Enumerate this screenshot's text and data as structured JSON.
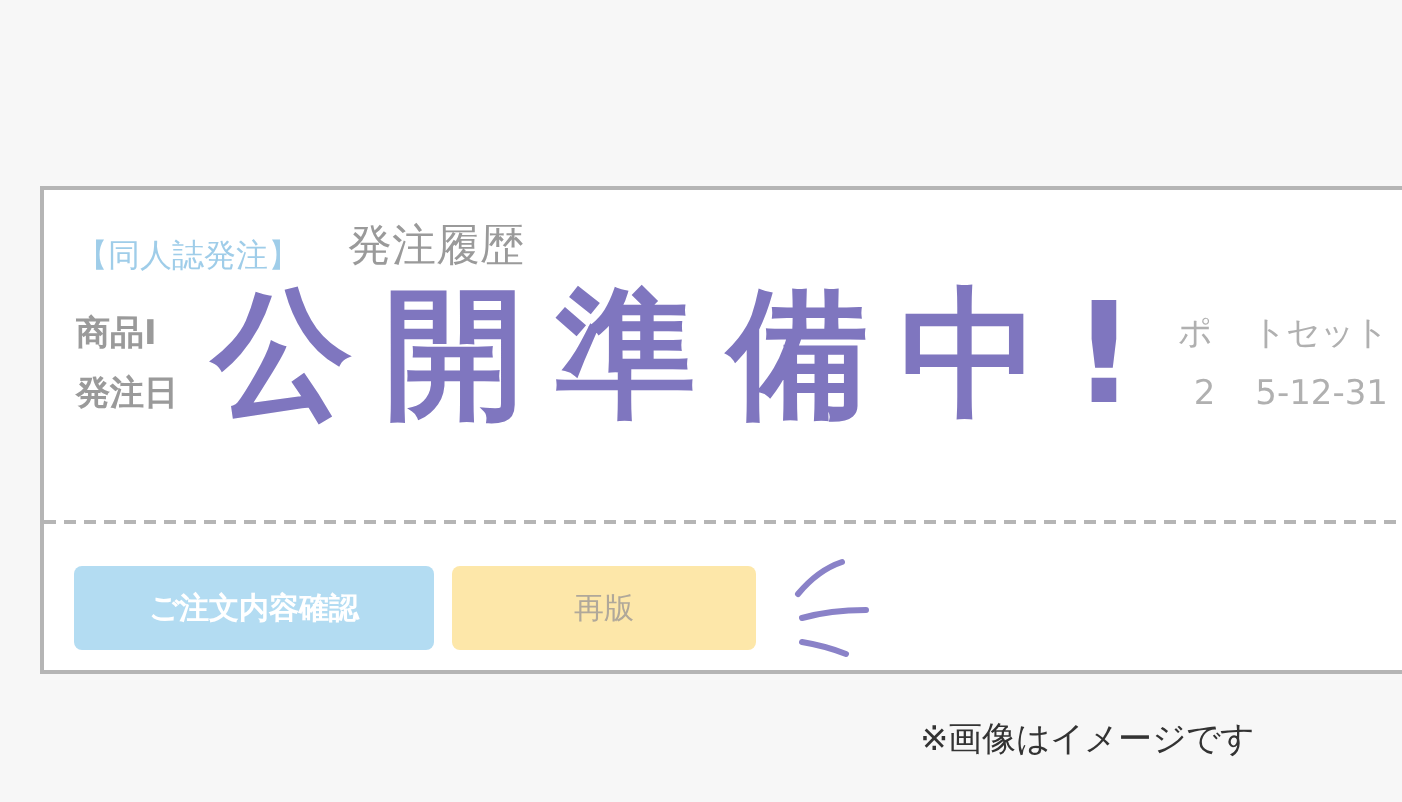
{
  "card": {
    "tag": "【同人誌発注】",
    "title": "発注履歴",
    "rows": [
      {
        "label": "商品I",
        "value_parts": [
          "ポ",
          "トセット"
        ]
      },
      {
        "label": "発注日",
        "value_parts": [
          "2",
          "5-12-31"
        ]
      }
    ],
    "buttons": [
      {
        "label": "ご注文内容確認",
        "kind": "primary"
      },
      {
        "label": "再版",
        "kind": "secondary"
      }
    ]
  },
  "overlay": "公開準備中!",
  "caption": "※画像はイメージです"
}
